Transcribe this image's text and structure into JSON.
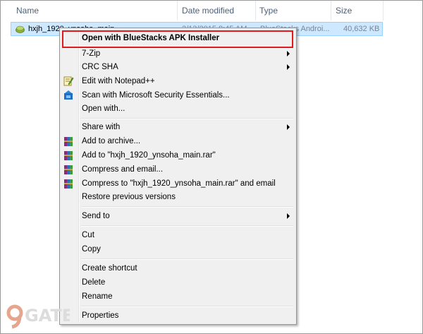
{
  "columns": {
    "name": "Name",
    "date_modified": "Date modified",
    "type": "Type",
    "size": "Size"
  },
  "file": {
    "name": "hxjh_1920_ynsoha_main",
    "date": "2/13/2015 8:45 AM",
    "type": "BlueStacks Androi...",
    "size": "40,632 KB",
    "icon": "apk-file-icon"
  },
  "menu": {
    "open_with_bluestacks": "Open with BlueStacks APK Installer",
    "seven_zip": "7-Zip",
    "crc_sha": "CRC SHA",
    "edit_notepad": "Edit with Notepad++",
    "scan_mse": "Scan with Microsoft Security Essentials...",
    "open_with": "Open with...",
    "share_with": "Share with",
    "add_to_archive": "Add to archive...",
    "add_to_rar": "Add to \"hxjh_1920_ynsoha_main.rar\"",
    "compress_email": "Compress and email...",
    "compress_rar_email": "Compress to \"hxjh_1920_ynsoha_main.rar\" and email",
    "restore_versions": "Restore previous versions",
    "send_to": "Send to",
    "cut": "Cut",
    "copy": "Copy",
    "create_shortcut": "Create shortcut",
    "delete": "Delete",
    "rename": "Rename",
    "properties": "Properties"
  },
  "colors": {
    "highlight_border": "#e01b1b",
    "selection_bg": "#cde8ff",
    "menu_bg": "#f0f0f0"
  },
  "watermark": {
    "logo_text": "9GATE"
  }
}
